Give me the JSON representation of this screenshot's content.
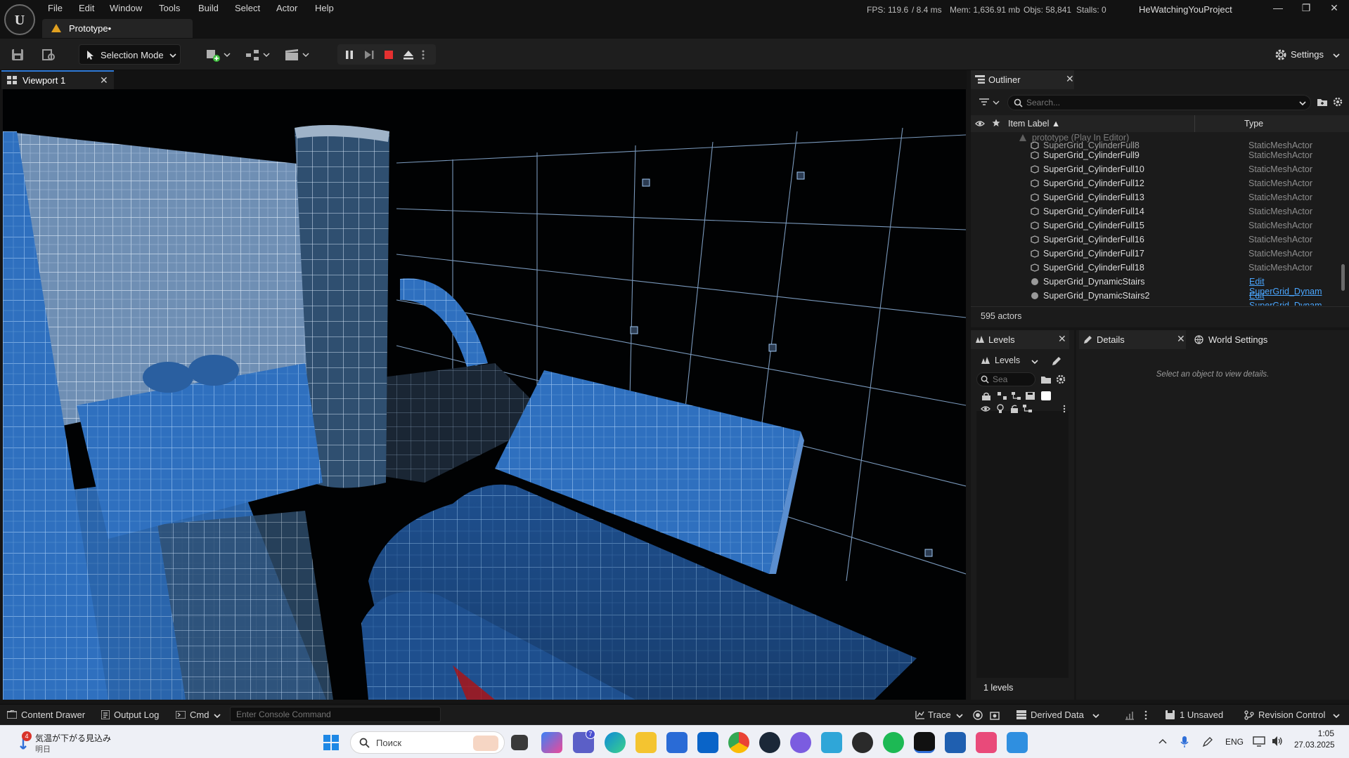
{
  "menu": [
    "File",
    "Edit",
    "Window",
    "Tools",
    "Build",
    "Select",
    "Actor",
    "Help"
  ],
  "project_tab": "Prototype•",
  "stats": {
    "fps": "FPS: 119.6",
    "ms": "/ 8.4 ms",
    "mem": "Mem: 1,636.91 mb",
    "objs": "Objs: 58,841",
    "stalls": "Stalls: 0"
  },
  "project_name": "HeWatchingYouProject",
  "window_controls": {
    "minimize": "—",
    "restore": "❐",
    "close": "✕"
  },
  "toolbar": {
    "selection_mode": "Selection Mode",
    "settings": "Settings"
  },
  "viewport": {
    "tab": "Viewport 1"
  },
  "outliner": {
    "tab": "Outliner",
    "search_placeholder": "Search...",
    "col_label": "Item Label ▲",
    "col_type": "Type",
    "pie_row": "prototype (Play In Editor)",
    "rows": [
      {
        "name": "SuperGrid_CylinderFull8",
        "type": "StaticMeshActor"
      },
      {
        "name": "SuperGrid_CylinderFull9",
        "type": "StaticMeshActor"
      },
      {
        "name": "SuperGrid_CylinderFull10",
        "type": "StaticMeshActor"
      },
      {
        "name": "SuperGrid_CylinderFull12",
        "type": "StaticMeshActor"
      },
      {
        "name": "SuperGrid_CylinderFull13",
        "type": "StaticMeshActor"
      },
      {
        "name": "SuperGrid_CylinderFull14",
        "type": "StaticMeshActor"
      },
      {
        "name": "SuperGrid_CylinderFull15",
        "type": "StaticMeshActor"
      },
      {
        "name": "SuperGrid_CylinderFull16",
        "type": "StaticMeshActor"
      },
      {
        "name": "SuperGrid_CylinderFull17",
        "type": "StaticMeshActor"
      },
      {
        "name": "SuperGrid_CylinderFull18",
        "type": "StaticMeshActor"
      },
      {
        "name": "SuperGrid_DynamicStairs",
        "type": "Edit SuperGrid_Dynam"
      },
      {
        "name": "SuperGrid_DynamicStairs2",
        "type": "Edit SuperGrid_Dynam"
      }
    ],
    "count": "595 actors"
  },
  "levels": {
    "tab": "Levels",
    "dropdown": "Levels",
    "search_placeholder": "Sea",
    "count": "1 levels"
  },
  "details": {
    "tab": "Details",
    "world_tab": "World Settings",
    "empty_msg": "Select an object to view details."
  },
  "statusbar": {
    "content_drawer": "Content Drawer",
    "output_log": "Output Log",
    "cmd": "Cmd",
    "console_placeholder": "Enter Console Command",
    "trace": "Trace",
    "derived_data": "Derived Data",
    "unsaved": "1 Unsaved",
    "revision": "Revision Control"
  },
  "taskbar": {
    "weather_title": "気温が下がる見込み",
    "weather_sub": "明日",
    "weather_badge": "4",
    "search": "Поиск",
    "teams_badge": "7",
    "lang": "ENG",
    "time": "1:05",
    "date": "27.03.2025"
  },
  "colors": {
    "accent": "#2f7bd8",
    "link": "#4aa6ff",
    "grid_blue": "#2b6fc0"
  }
}
